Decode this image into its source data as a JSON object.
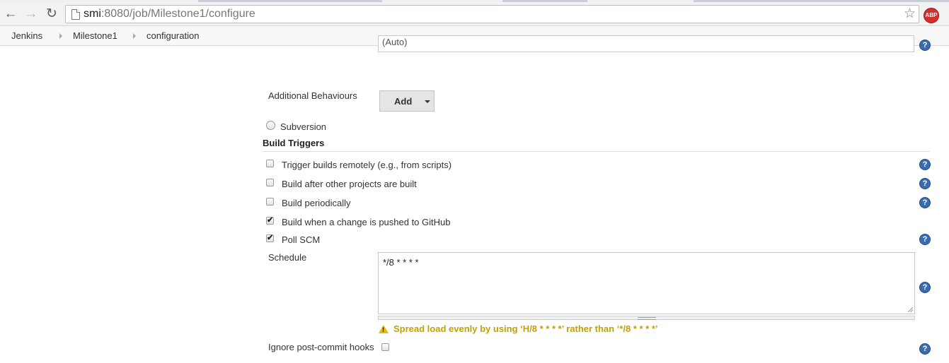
{
  "browser": {
    "url_host": "smi",
    "url_rest": ":8080/job/Milestone1/configure",
    "abp_label": "ABP"
  },
  "breadcrumbs": [
    "Jenkins",
    "Milestone1",
    "configuration"
  ],
  "scm": {
    "top_field_value": "(Auto)",
    "additional_behaviours_label": "Additional Behaviours",
    "add_button_label": "Add",
    "subversion_label": "Subversion"
  },
  "build_triggers": {
    "title": "Build Triggers",
    "items": [
      {
        "label": "Trigger builds remotely (e.g., from scripts)",
        "checked": false
      },
      {
        "label": "Build after other projects are built",
        "checked": false
      },
      {
        "label": "Build periodically",
        "checked": false
      },
      {
        "label": "Build when a change is pushed to GitHub",
        "checked": true
      },
      {
        "label": "Poll SCM",
        "checked": true
      }
    ],
    "schedule_label": "Schedule",
    "schedule_value": "*/8 * * * *",
    "warning": "Spread load evenly by using ‘H/8 * * * *’ rather than ‘*/8 * * * *’",
    "ignore_hooks_label": "Ignore post-commit hooks",
    "ignore_hooks_checked": false
  },
  "icons": {
    "help": "?",
    "check": "✔",
    "warning": "!"
  },
  "colors": {
    "help_icon": "#3b6cb0",
    "warning_text": "#c4a000",
    "abp_badge": "#d32f2f"
  }
}
